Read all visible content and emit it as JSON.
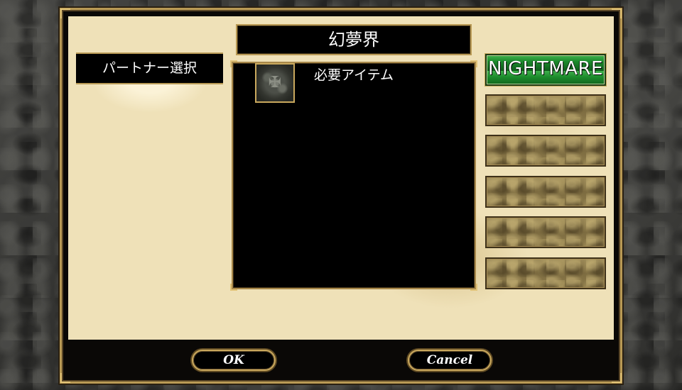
{
  "window": {
    "title": "幻夢界"
  },
  "partner": {
    "select_label": "パートナー選択"
  },
  "items_panel": {
    "label": "必要アイテム",
    "slots": [
      {
        "icon": "rune-stone-icon"
      },
      {
        "icon": "rune-stone-icon"
      },
      {
        "icon": "rune-stone-icon"
      }
    ]
  },
  "difficulty": {
    "buttons": [
      {
        "label": "NIGHTMARE",
        "active": true,
        "color": "#1c8a2c"
      },
      {
        "label": "",
        "active": false
      },
      {
        "label": "",
        "active": false
      },
      {
        "label": "",
        "active": false
      },
      {
        "label": "",
        "active": false
      },
      {
        "label": "",
        "active": false
      }
    ]
  },
  "actions": {
    "ok_label": "OK",
    "cancel_label": "Cancel"
  },
  "colors": {
    "gold_border": "#b99a55",
    "parchment": "#efe1b8",
    "panel_bg": "#000000",
    "active_green": "#1c8a2c"
  }
}
